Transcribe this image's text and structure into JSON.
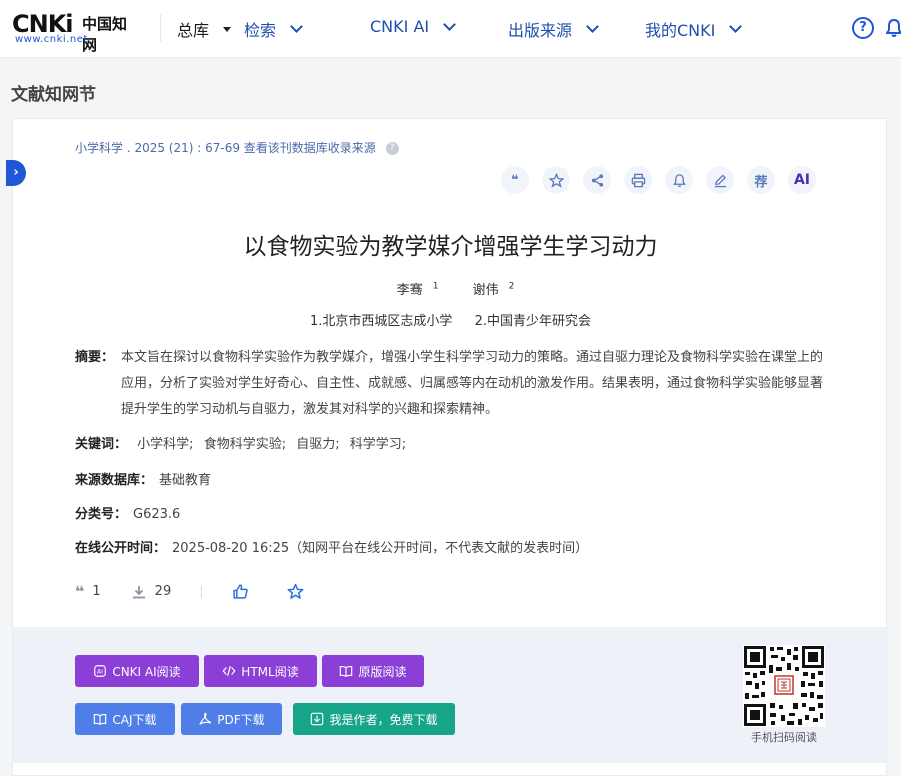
{
  "header": {
    "logo_mark": "CNKi",
    "logo_cn": "中国知网",
    "logo_url": "www.cnki.net",
    "nav": [
      {
        "label": "总库"
      },
      {
        "label": "检索"
      },
      {
        "label": "CNKI AI"
      },
      {
        "label": "出版来源"
      },
      {
        "label": "我的CNKI"
      }
    ]
  },
  "page": {
    "section_title": "文献知网节"
  },
  "article": {
    "meta": "小学科学 .  2025 (21)  : 67-69  查看该刊数据库收录来源",
    "tools": [
      {
        "name": "cite-icon",
        "glyph": "❝"
      },
      {
        "name": "favorite-icon"
      },
      {
        "name": "share-icon"
      },
      {
        "name": "print-icon"
      },
      {
        "name": "alert-icon"
      },
      {
        "name": "note-icon"
      },
      {
        "name": "recommend-icon",
        "glyph": "荐"
      },
      {
        "name": "ai-icon",
        "glyph": "AI"
      }
    ],
    "title": "以食物实验为教学媒介增强学生学习动力",
    "authors": [
      {
        "name": "李骞",
        "sup": "1"
      },
      {
        "name": "谢伟",
        "sup": "2"
      }
    ],
    "orgs": [
      "1.北京市西城区志成小学",
      "2.中国青少年研究会"
    ],
    "abstract_label": "摘要：",
    "abstract": "本文旨在探讨以食物科学实验作为教学媒介，增强小学生科学学习动力的策略。通过自驱力理论及食物科学实验在课堂上的应用，分析了实验对学生好奇心、自主性、成就感、归属感等内在动机的激发作用。结果表明，通过食物科学实验能够显著提升学生的学习动机与自驱力，激发其对科学的兴趣和探索精神。",
    "keywords_label": "关键词：",
    "keywords": [
      "小学科学;",
      "食物科学实验;",
      "自驱力;",
      "科学学习;"
    ],
    "source_label": "来源数据库：",
    "source": "基础教育",
    "class_label": "分类号：",
    "class_no": "G623.6",
    "online_label": "在线公开时间：",
    "online": "2025-08-20 16:25（知网平台在线公开时间，不代表文献的发表时间）",
    "cite_count": "1",
    "download_count": "29"
  },
  "actions": {
    "cnki_ai_read": "CNKI AI阅读",
    "html_read": "HTML阅读",
    "original_read": "原版阅读",
    "caj_download": "CAJ下载",
    "pdf_download": "PDF下载",
    "author_download": "我是作者，免费下载",
    "qr_label": "手机扫码阅读"
  },
  "colors": {
    "brand": "#1f57d8",
    "purple": "#8b3fd6",
    "blue": "#4f7ee8",
    "green": "#17a58a"
  }
}
